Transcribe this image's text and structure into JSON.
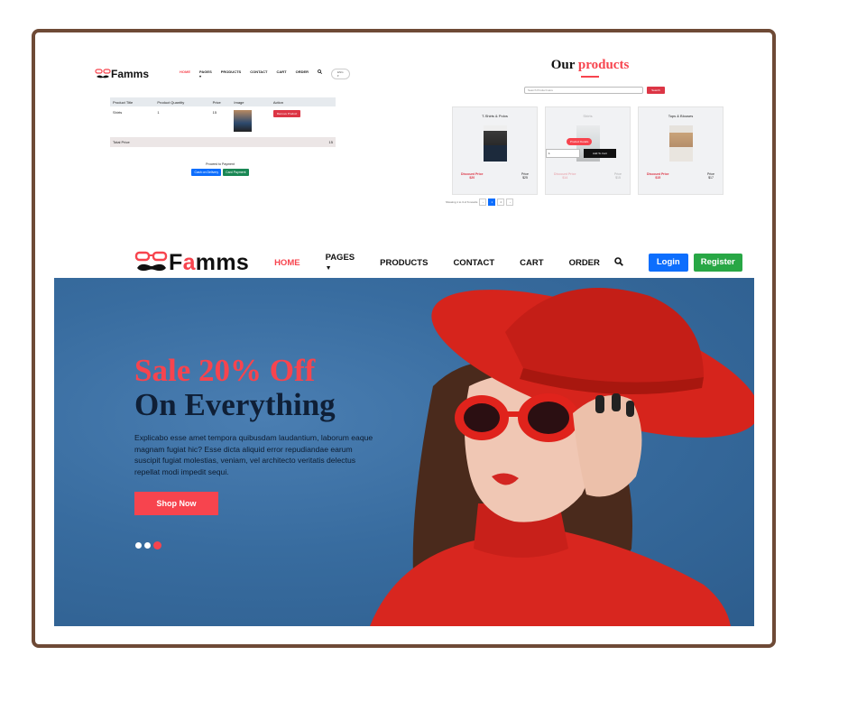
{
  "mini_cart": {
    "logo": "Famms",
    "nav": [
      "HOME",
      "PAGES",
      "PRODUCTS",
      "CONTACT",
      "CART",
      "ORDER"
    ],
    "lang": "ENG",
    "table_headers": [
      "Product Title",
      "Product Quantity",
      "Price",
      "Image",
      "Action"
    ],
    "row": {
      "title": "Shirts",
      "quantity": "1",
      "price": "15",
      "action": "Remove Product"
    },
    "total_label": "Total Price",
    "total_value": "15",
    "proceed_label": "Proceed to Payment",
    "cash_label": "Cash on Delivery",
    "card_label": "Card Payment"
  },
  "mini_products": {
    "title_1": "Our",
    "title_2": "products",
    "search_placeholder": "Search Product Here",
    "search_button": "Search",
    "cards": [
      {
        "name": "T-Shirts & Polos",
        "discount_label": "Discount Price",
        "discount_value": "$20",
        "price_label": "Price",
        "price_value": "$25"
      },
      {
        "name": "Shirts",
        "discount_label": "Discount Price",
        "discount_value": "$14",
        "price_label": "Price",
        "price_value": "$15"
      },
      {
        "name": "Tops & Blouses",
        "discount_label": "Discount Price",
        "discount_value": "$15",
        "price_label": "Price",
        "price_value": "$17"
      }
    ],
    "overlay_details": "Product Details",
    "overlay_qty": "1",
    "overlay_cart": "Add To Cart",
    "pager_text": "Showing 1 to 3 of 6 results",
    "pages": [
      "‹",
      "1",
      "2",
      "›"
    ]
  },
  "nav": {
    "logo_pre": "F",
    "logo_accent": "a",
    "logo_post": "mms",
    "home": "HOME",
    "pages": "PAGES",
    "products": "PRODUCTS",
    "contact": "CONTACT",
    "cart": "CART",
    "order": "ORDER",
    "login": "Login",
    "register": "Register"
  },
  "hero": {
    "line1": "Sale 20% Off",
    "line2": "On Everything",
    "text": "Explicabo esse amet tempora quibusdam laudantium, laborum eaque magnam fugiat hic? Esse dicta aliquid error repudiandae earum suscipit fugiat molestias, veniam, vel architecto veritatis delectus repellat modi impedit sequi.",
    "button": "Shop Now",
    "slides_active": 3
  },
  "colors": {
    "accent": "#f7444e",
    "frame": "#6e4a36",
    "hero_bg": "#386c9f",
    "login": "#0d6efd",
    "register": "#28a745"
  }
}
